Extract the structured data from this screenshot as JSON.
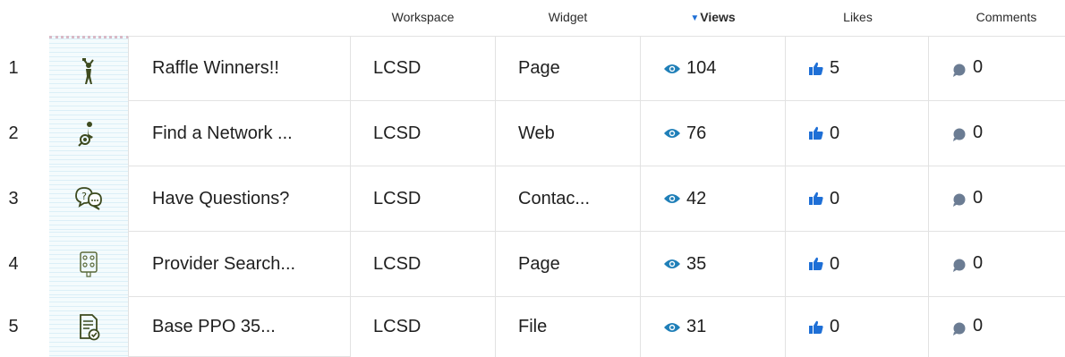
{
  "header": {
    "workspace": "Workspace",
    "widget": "Widget",
    "views": "Views",
    "likes": "Likes",
    "comments": "Comments"
  },
  "colors": {
    "accent_blue": "#1e6fd6",
    "eye_blue": "#1f7fb8",
    "comment_gray": "#6b7c93",
    "icon_green": "#3d4a1e"
  },
  "rows": [
    {
      "rank": "1",
      "icon": "trophy-person-icon",
      "title": "Raffle Winners!!",
      "workspace": "LCSD",
      "widget": "Page",
      "views": "104",
      "likes": "5",
      "comments": "0"
    },
    {
      "rank": "2",
      "icon": "network-search-icon",
      "title": "Find a Network ...",
      "workspace": "LCSD",
      "widget": "Web",
      "views": "76",
      "likes": "0",
      "comments": "0"
    },
    {
      "rank": "3",
      "icon": "question-chat-icon",
      "title": "Have Questions?",
      "workspace": "LCSD",
      "widget": "Contac...",
      "views": "42",
      "likes": "0",
      "comments": "0"
    },
    {
      "rank": "4",
      "icon": "provider-directory-icon",
      "title": "Provider Search...",
      "workspace": "LCSD",
      "widget": "Page",
      "views": "35",
      "likes": "0",
      "comments": "0"
    },
    {
      "rank": "5",
      "icon": "document-check-icon",
      "title": "Base PPO 35...",
      "workspace": "LCSD",
      "widget": "File",
      "views": "31",
      "likes": "0",
      "comments": "0"
    }
  ]
}
